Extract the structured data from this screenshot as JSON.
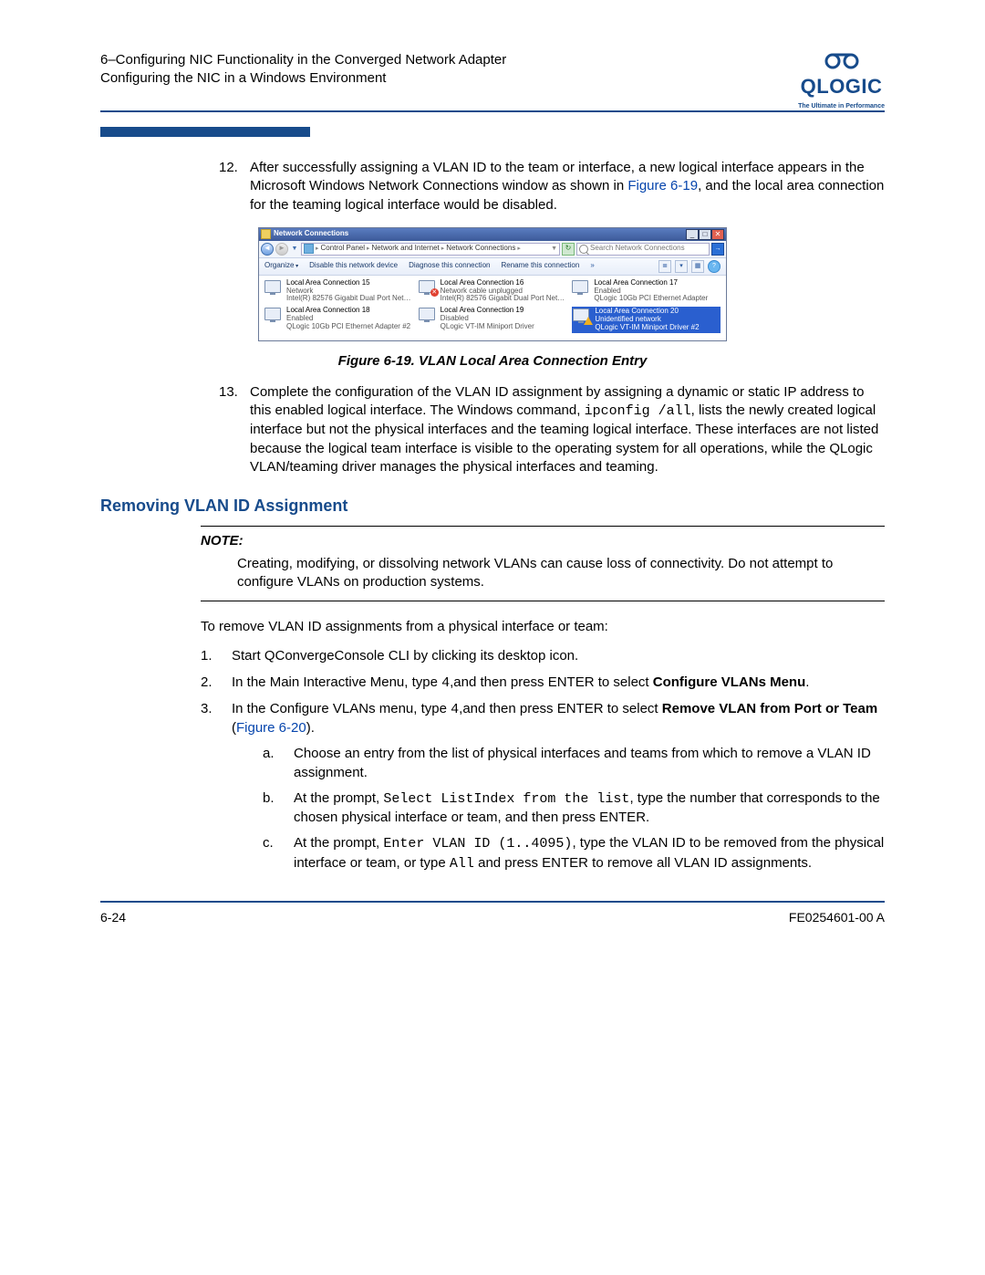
{
  "header": {
    "line1": "6–Configuring NIC Functionality in the Converged Network Adapter",
    "line2": "Configuring the NIC in a Windows Environment",
    "logo_text": "QLOGIC",
    "logo_tag": "The Ultimate in Performance"
  },
  "step12": {
    "num": "12.",
    "text_a": "After successfully assigning a VLAN ID to the team or interface, a new logical interface appears in the Microsoft Windows Network Connections window as shown in ",
    "link": "Figure 6-19",
    "text_b": ", and the local area connection for the teaming logical interface would be disabled."
  },
  "shot": {
    "title": "Network Connections",
    "breadcrumbs": [
      "Control Panel",
      "Network and Internet",
      "Network Connections"
    ],
    "search_placeholder": "Search Network Connections",
    "toolbar": {
      "organize": "Organize",
      "disable": "Disable this network device",
      "diagnose": "Diagnose this connection",
      "rename": "Rename this connection"
    },
    "items": [
      {
        "name": "Local Area Connection 15",
        "status": "Network",
        "detail": "Intel(R) 82576 Gigabit Dual Port Net…",
        "badge": "none"
      },
      {
        "name": "Local Area Connection 16",
        "status": "Network cable unplugged",
        "detail": "Intel(R) 82576 Gigabit Dual Port Net…",
        "badge": "x"
      },
      {
        "name": "Local Area Connection 17",
        "status": "Enabled",
        "detail": "QLogic 10Gb PCI Ethernet Adapter",
        "badge": "none"
      },
      {
        "name": "Local Area Connection 18",
        "status": "Enabled",
        "detail": "QLogic 10Gb PCI Ethernet Adapter #2",
        "badge": "none"
      },
      {
        "name": "Local Area Connection 19",
        "status": "Disabled",
        "detail": "QLogic VT-IM Miniport Driver",
        "badge": "none"
      },
      {
        "name": "Local Area Connection 20",
        "status": "Unidentified network",
        "detail": "QLogic VT-IM Miniport Driver #2",
        "badge": "warn",
        "selected": true
      }
    ]
  },
  "fig_caption": "Figure 6-19. VLAN Local Area Connection Entry",
  "step13": {
    "num": "13.",
    "text_a": "Complete the configuration of the VLAN ID assignment by assigning a dynamic or static IP address to this enabled logical interface. The Windows command, ",
    "code": "ipconfig /all",
    "text_b": ", lists the newly created logical interface but not the physical interfaces and the teaming logical interface. These interfaces are not listed because the logical team interface is visible to the operating system for all operations, while the QLogic VLAN/teaming driver manages the physical interfaces and teaming."
  },
  "section_heading": "Removing VLAN ID Assignment",
  "note": {
    "label": "NOTE:",
    "body": "Creating, modifying, or dissolving network VLANs can cause loss of connectivity. Do not attempt to configure VLANs on production systems."
  },
  "intro": "To remove VLAN ID assignments from a physical interface or team:",
  "r1": {
    "num": "1.",
    "text": "Start QConvergeConsole CLI by clicking its desktop icon."
  },
  "r2": {
    "num": "2.",
    "a": "In the Main Interactive Menu, type ",
    "code": "4",
    "b": ",and then press ENTER to select ",
    "bold": "Configure VLANs Menu",
    "c": "."
  },
  "r3": {
    "num": "3.",
    "a": "In the Configure VLANs menu, type ",
    "code": "4",
    "b": ",and then press ENTER to select ",
    "bold": "Remove VLAN from Port or Team",
    "c": " (",
    "link": "Figure 6-20",
    "d": ")."
  },
  "sa": {
    "let": "a.",
    "text": "Choose an entry from the list of physical interfaces and teams from which to remove a VLAN ID assignment."
  },
  "sb": {
    "let": "b.",
    "a": "At the prompt, ",
    "code": "Select ListIndex from the list",
    "b": ", type the number that corresponds to the chosen physical interface or team, and then press ENTER."
  },
  "sc": {
    "let": "c.",
    "a": "At the prompt, ",
    "code": "Enter VLAN ID (1..4095)",
    "b": ", type the VLAN ID to be removed from the physical interface or team, or type ",
    "code2": "All",
    "c": " and press ENTER to remove all VLAN ID assignments."
  },
  "footer": {
    "left": "6-24",
    "right": "FE0254601-00 A"
  }
}
